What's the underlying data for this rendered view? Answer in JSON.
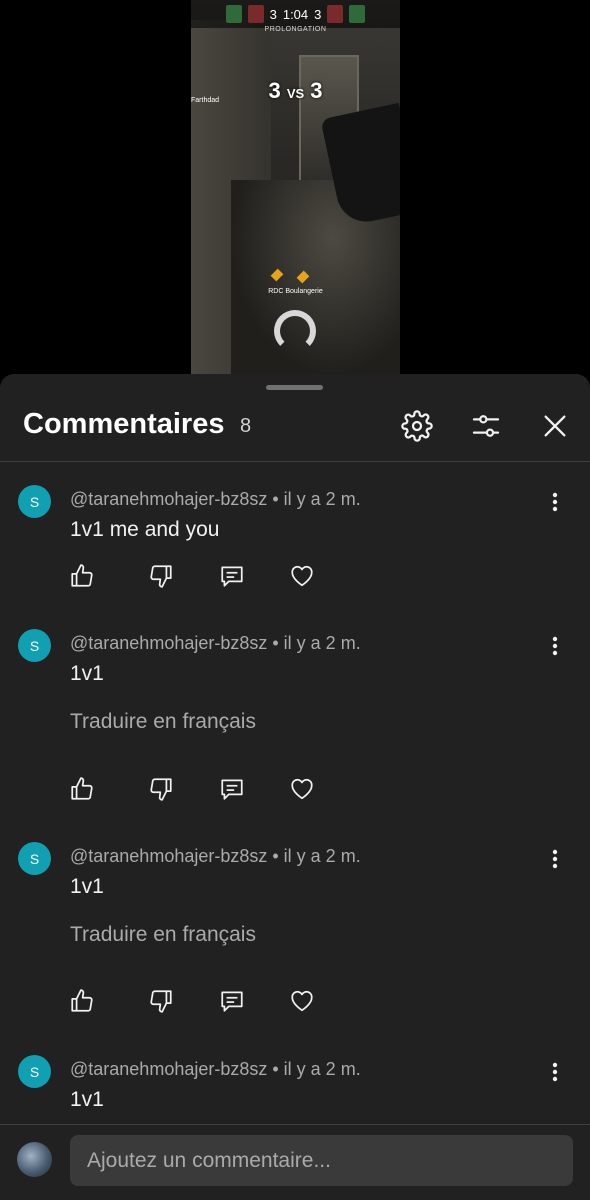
{
  "video": {
    "hud_time": "1:04",
    "hud_left_count": "3",
    "hud_right_count": "3",
    "hud_subtitle": "PROLONGATION",
    "score_left": "3",
    "score_vs": "VS",
    "score_right": "3",
    "player_name": "Farthdad",
    "location": "RDC Boulangerie"
  },
  "panel": {
    "title": "Commentaires",
    "count": "8",
    "icons": [
      "gear-icon",
      "sliders-icon",
      "close-icon"
    ]
  },
  "comments": [
    {
      "avatar_letter": "S",
      "meta": "@taranehmohajer-bz8sz • il y a 2 m.",
      "text": "1v1 me and you",
      "translate": ""
    },
    {
      "avatar_letter": "S",
      "meta": "@taranehmohajer-bz8sz • il y a 2 m.",
      "text": "1v1",
      "translate": "Traduire en français"
    },
    {
      "avatar_letter": "S",
      "meta": "@taranehmohajer-bz8sz • il y a 2 m.",
      "text": "1v1",
      "translate": "Traduire en français"
    },
    {
      "avatar_letter": "S",
      "meta": "@taranehmohajer-bz8sz • il y a 2 m.",
      "text": "1v1",
      "translate": ""
    }
  ],
  "composer": {
    "placeholder": "Ajoutez un commentaire..."
  },
  "colors": {
    "sheet_bg": "#212121",
    "avatar_bg": "#11a0b2",
    "muted_text": "#aaaaaa",
    "input_bg": "#3a3a3a"
  }
}
